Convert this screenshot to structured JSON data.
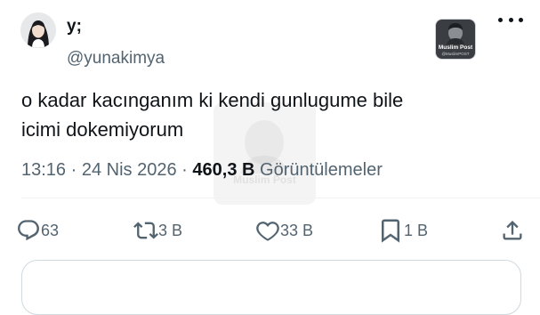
{
  "tweet": {
    "author_name": "y;",
    "author_handle": "@yunakimya",
    "text_line1": "o kadar kacınganım ki kendi gunlugume bile",
    "text_line2": "icimi dokemiyorum",
    "time": "13:16",
    "date": "24 Nis 2026",
    "separator": "·",
    "views_count": "460,3 B",
    "views_label": "Görüntülemeler"
  },
  "badge": {
    "title": "Muslim Post",
    "subtitle": "@MuslimPOST"
  },
  "watermark": {
    "title": "Muslim Post"
  },
  "actions": {
    "reply_count": "63",
    "retweet_count": "3 B",
    "like_count": "33 B",
    "bookmark_count": "1 B"
  },
  "icons": {
    "more": "more-icon",
    "reply": "reply-icon",
    "retweet": "retweet-icon",
    "like": "like-icon",
    "bookmark": "bookmark-icon",
    "share": "share-icon"
  },
  "colors": {
    "text_primary": "#0f1419",
    "text_secondary": "#536471",
    "divider": "#eff3f4"
  }
}
